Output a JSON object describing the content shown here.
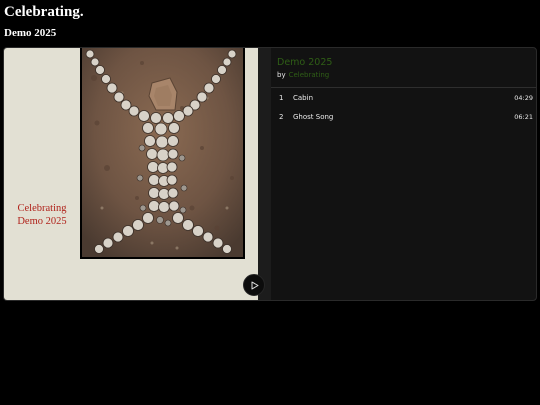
{
  "page": {
    "title": "Celebrating."
  },
  "album": {
    "heading": "Demo 2025",
    "cover_text": "Celebrating Demo 2025",
    "title": "Demo 2025",
    "by_label": "by",
    "artist": "Celebrating"
  },
  "controls": {
    "play_icon": "play-icon"
  },
  "tracks": [
    {
      "number": "1",
      "title": "Cabin",
      "duration": "04:29"
    },
    {
      "number": "2",
      "title": "Ghost Song",
      "duration": "06:21"
    }
  ],
  "colors": {
    "accent": "#2f5e16",
    "cover_bg": "#e2e0d3",
    "cover_text": "#b0231b"
  }
}
